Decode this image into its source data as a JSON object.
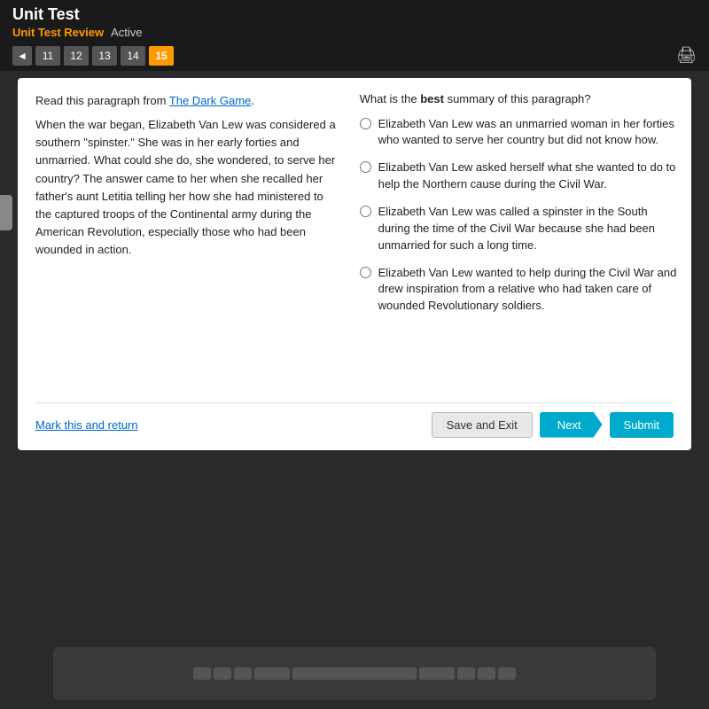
{
  "header": {
    "title": "Unit Test",
    "subtitle": "Unit Test Review",
    "status": "Active"
  },
  "navigation": {
    "prev_arrow": "◄",
    "tabs": [
      {
        "number": "11",
        "active": false
      },
      {
        "number": "12",
        "active": false
      },
      {
        "number": "13",
        "active": false
      },
      {
        "number": "14",
        "active": false
      },
      {
        "number": "15",
        "active": true
      }
    ]
  },
  "passage": {
    "prompt_prefix": "Read this paragraph from ",
    "book_title": "The Dark Game",
    "prompt_suffix": ".",
    "text": "When the war began, Elizabeth Van Lew was considered a southern \"spinster.\" She was in her early forties and unmarried. What could she do, she wondered, to serve her country? The answer came to her when she recalled her father's aunt Letitia telling her how she had ministered to the captured troops of the Continental army during the American Revolution, especially those who had been wounded in action."
  },
  "question": {
    "prompt": "What is the ",
    "prompt_bold": "best",
    "prompt_end": " summary of this paragraph?",
    "options": [
      {
        "id": "optA",
        "text": "Elizabeth Van Lew was an unmarried woman in her forties who wanted to serve her country but did not know how."
      },
      {
        "id": "optB",
        "text": "Elizabeth Van Lew asked herself what she wanted to do to help the Northern cause during the Civil War."
      },
      {
        "id": "optC",
        "text": "Elizabeth Van Lew was called a spinster in the South during the time of the Civil War because she had been unmarried for such a long time."
      },
      {
        "id": "optD",
        "text": "Elizabeth Van Lew wanted to help during the Civil War and drew inspiration from a relative who had taken care of wounded Revolutionary soldiers."
      }
    ]
  },
  "footer": {
    "mark_return": "Mark this and return",
    "save_exit": "Save and Exit",
    "next": "Next",
    "submit": "Submit"
  }
}
